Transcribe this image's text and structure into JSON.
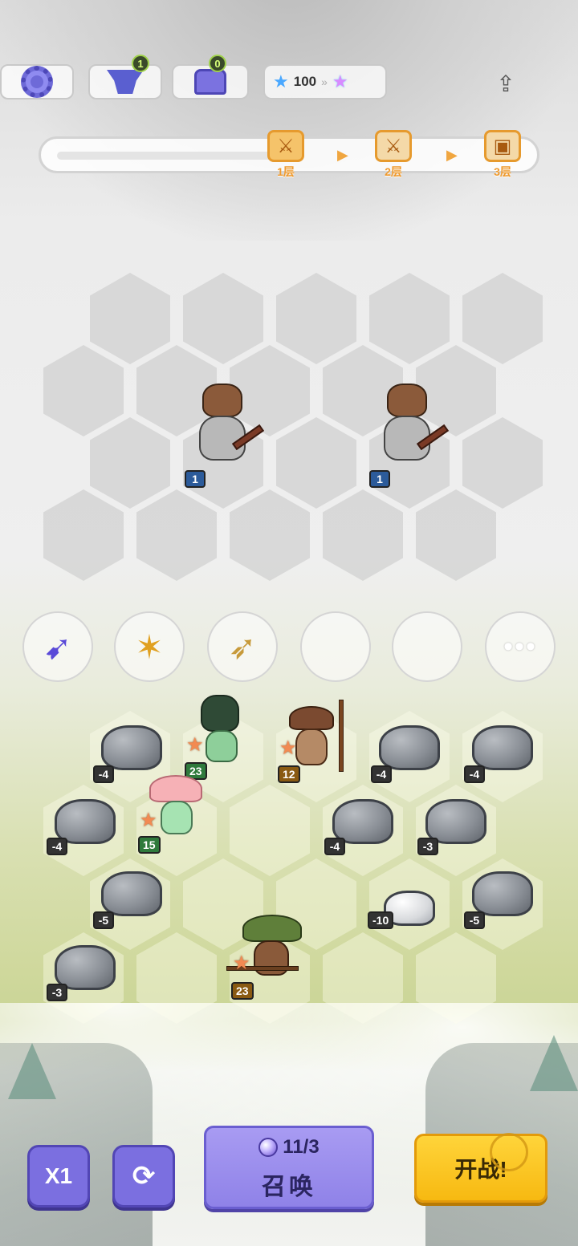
{
  "top_bar": {
    "forge_count": "1",
    "chest_count": "0",
    "star_currency": "100"
  },
  "floors": [
    {
      "label": "1层",
      "state": "current"
    },
    {
      "label": "2层",
      "state": "locked"
    },
    {
      "label": "3层",
      "state": "locked"
    }
  ],
  "enemies": [
    {
      "name": "bearded-swordsman",
      "level": "1"
    },
    {
      "name": "bearded-swordsman",
      "level": "1"
    }
  ],
  "equipment_slots": [
    {
      "icon": "violet-bow-icon",
      "filled": true
    },
    {
      "icon": "golden-crossbow-icon",
      "filled": true
    },
    {
      "icon": "longbow-icon",
      "filled": true
    },
    {
      "icon": "empty-slot",
      "filled": false
    },
    {
      "icon": "empty-slot",
      "filled": false
    },
    {
      "icon": "more-icon",
      "filled": false,
      "text": "•••"
    }
  ],
  "allies": [
    {
      "name": "green-hair-girl",
      "level": "23"
    },
    {
      "name": "mushroom-spearman",
      "level": "12"
    },
    {
      "name": "pink-mushroom-girl",
      "level": "15"
    },
    {
      "name": "green-mushroom-crossbowman",
      "level": "23"
    }
  ],
  "rocks": [
    {
      "value": "-4"
    },
    {
      "value": "-4"
    },
    {
      "value": "-4"
    },
    {
      "value": "-4"
    },
    {
      "value": "-4"
    },
    {
      "value": "-3"
    },
    {
      "value": "-5"
    },
    {
      "value": "-10"
    },
    {
      "value": "-5"
    },
    {
      "value": "-3"
    }
  ],
  "controls": {
    "speed_label": "X1",
    "summon_cost": "11/3",
    "summon_label": "召唤",
    "battle_label": "开战!"
  },
  "colors": {
    "ally_star": "#f28a52",
    "enemy_level_tag": "#2c5b9a",
    "summon_button": "#8f82e8",
    "battle_button": "#f7b911",
    "floor_accent": "#ef9a2e"
  }
}
